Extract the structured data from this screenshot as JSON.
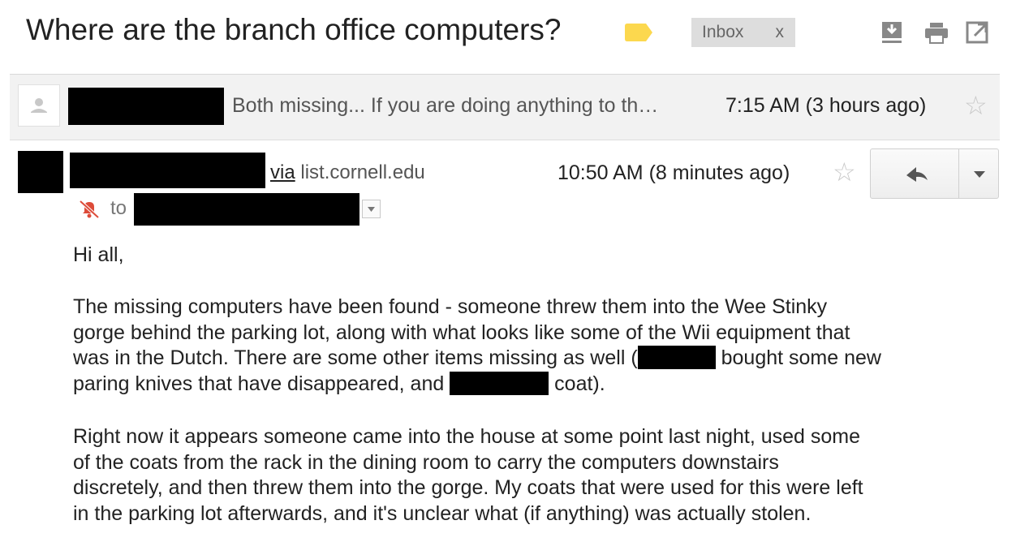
{
  "header": {
    "subject": "Where are the branch office computers?",
    "label_icon": "label-tag-icon",
    "inbox_chip": {
      "label": "Inbox",
      "remove": "x"
    },
    "icons": [
      "download-icon",
      "print-icon",
      "open-in-new-window-icon"
    ]
  },
  "collapsed_message": {
    "avatar_icon": "person-icon",
    "snippet": "Both missing... If you are doing anything to th…",
    "time": "7:15 AM (3 hours ago)",
    "star_icon": "star-icon"
  },
  "open_message": {
    "via_word": "via",
    "via_domain": "list.cornell.edu",
    "time": "10:50 AM (8 minutes ago)",
    "star_icon": "star-icon",
    "reply_icon": "reply-icon",
    "more_icon": "chevron-down-icon",
    "to_label": "to",
    "muted_icon": "notifications-off-icon"
  },
  "body": {
    "greeting": "Hi all,",
    "p1": {
      "line1": "The missing computers have been found - someone threw them into the Wee Stinky",
      "line2": "gorge behind the parking lot, along with what looks like some of the Wii equipment that",
      "line3a": "was in the Dutch. There are some other items missing as well (",
      "line3b": "bought some new",
      "line4a": "paring knives that have disappeared, and",
      "line4b": "coat)."
    },
    "p2": {
      "line1": "Right now it appears someone came into the house at some point last night, used some",
      "line2": "of the coats from the rack in the dining room to carry the computers downstairs",
      "line3": "discretely, and then threw them into the gorge. My coats that were used for this were left",
      "line4": "in the parking lot afterwards, and it's unclear what (if anything) was actually stolen."
    }
  },
  "colors": {
    "label_yellow": "#fcd84e",
    "chip_bg": "#dddddd",
    "collapsed_bg": "#f2f2f2",
    "muted_red": "#dd4b39",
    "icon_grey": "#888888"
  }
}
